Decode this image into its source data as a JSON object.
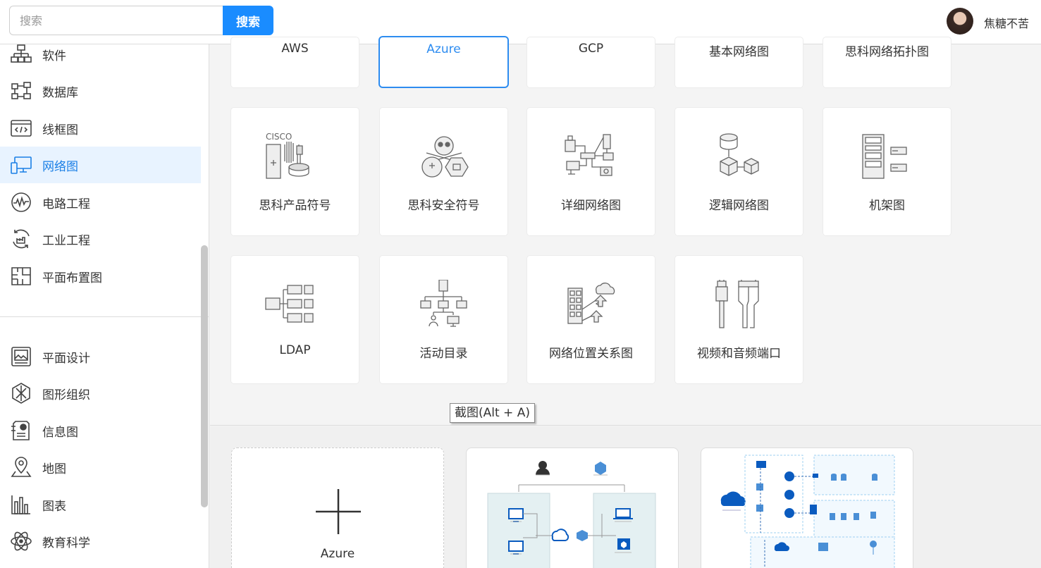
{
  "header": {
    "search_placeholder": "搜索",
    "search_button": "搜索",
    "username": "焦糖不苦"
  },
  "sidebar": {
    "items": [
      {
        "label": "软件",
        "icon": "org-tree-icon"
      },
      {
        "label": "数据库",
        "icon": "database-flow-icon"
      },
      {
        "label": "线框图",
        "icon": "code-window-icon"
      },
      {
        "label": "网络图",
        "icon": "monitor-network-icon",
        "active": true
      },
      {
        "label": "电路工程",
        "icon": "waveform-icon"
      },
      {
        "label": "工业工程",
        "icon": "industry-cycle-icon"
      },
      {
        "label": "平面布置图",
        "icon": "floorplan-icon"
      }
    ],
    "items2": [
      {
        "label": "平面设计",
        "icon": "image-frame-icon"
      },
      {
        "label": "图形组织",
        "icon": "hexagon-star-icon"
      },
      {
        "label": "信息图",
        "icon": "infographic-icon"
      },
      {
        "label": "地图",
        "icon": "map-pin-icon"
      },
      {
        "label": "图表",
        "icon": "bar-chart-icon"
      },
      {
        "label": "教育科学",
        "icon": "atom-icon"
      }
    ]
  },
  "categories": {
    "row1": [
      "AWS",
      "Azure",
      "GCP",
      "基本网络图",
      "思科网络拓扑图"
    ],
    "row2": [
      "思科产品符号",
      "思科安全符号",
      "详细网络图",
      "逻辑网络图",
      "机架图"
    ],
    "row3": [
      "LDAP",
      "活动目录",
      "网络位置关系图",
      "视频和音频端口"
    ],
    "active": "Azure",
    "cisco_text": "CISCO"
  },
  "tooltip": "截图(Alt + A)",
  "templates": {
    "new_label": "Azure"
  },
  "colors": {
    "accent": "#1a8cff",
    "active_bg": "#e8f3ff",
    "active_text": "#1a7fe6",
    "azure_blue": "#0a5bbf"
  }
}
